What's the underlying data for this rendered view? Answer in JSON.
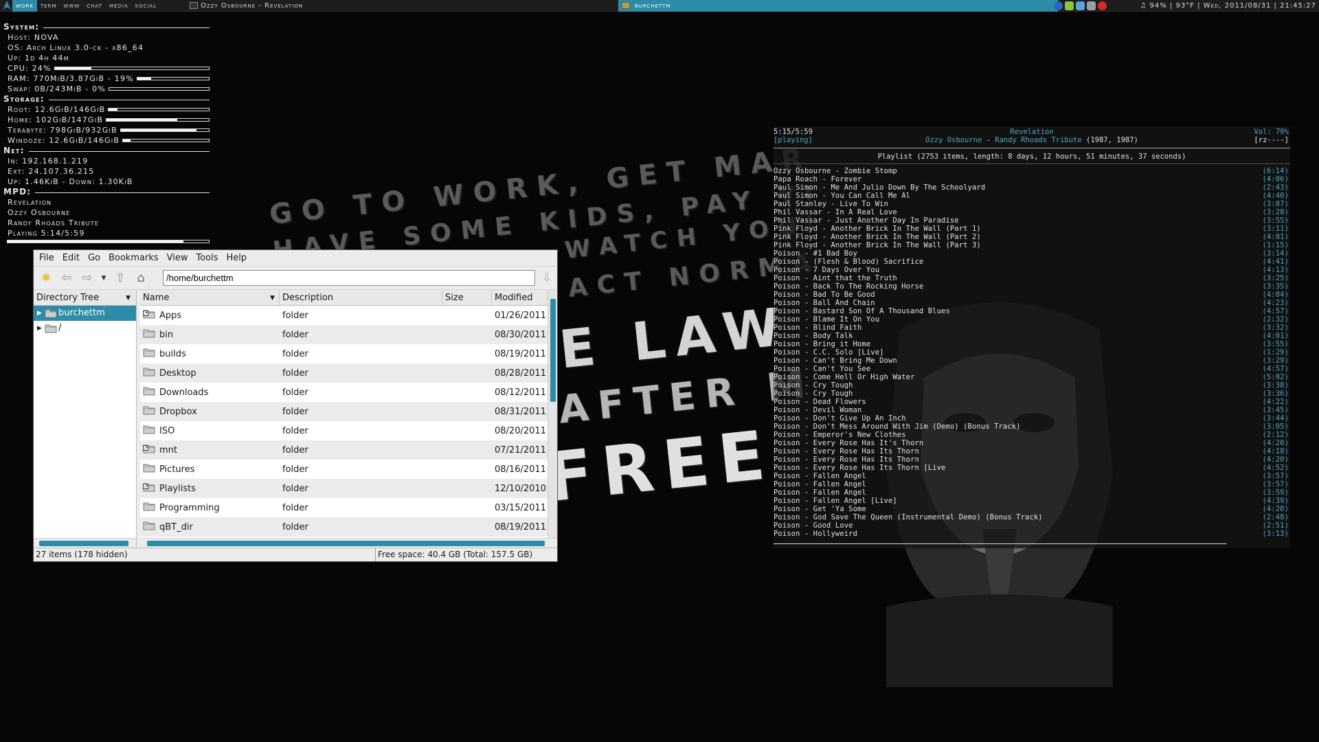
{
  "topbar": {
    "tags": [
      {
        "label": "work",
        "selected": true
      },
      {
        "label": "term",
        "selected": false
      },
      {
        "label": "www",
        "selected": false
      },
      {
        "label": "chat",
        "selected": false
      },
      {
        "label": "media",
        "selected": false
      },
      {
        "label": "social",
        "selected": false
      }
    ],
    "task_left": "Ozzy Osbourne - Revelation",
    "task_active": "burchettm",
    "tray_icons": [
      "network-icon",
      "pidgin-icon",
      "dropbox-icon",
      "updates-icon",
      "opera-icon"
    ],
    "status": "♫ 94% | 93°F | Wed, 2011/08/31 | 21:45:27",
    "accent": "#2d8ca8"
  },
  "conky": {
    "system_label": "System:",
    "host": "Host: NOVA",
    "os": "OS: Arch Linux 3.0-ck - x86_64",
    "uptime": "Up: 1d 4h 44m",
    "cpu": "CPU: 24%",
    "cpu_pct": 24,
    "ram": "RAM: 770MiB/3.87GiB - 19%",
    "ram_pct": 19,
    "swap": "Swap: 0B/243MiB - 0%",
    "swap_pct": 0,
    "storage_label": "Storage:",
    "root": "Root: 12.6GiB/146GiB",
    "root_pct": 9,
    "home": "Home: 102GiB/147GiB",
    "home_pct": 69,
    "terabyte": "Terabyte: 798GiB/932GiB",
    "terabyte_pct": 86,
    "windoze": "Windoze: 12.6GiB/146GiB",
    "windoze_pct": 9,
    "net_label": "Net:",
    "in": "In: 192.168.1.219",
    "ext": "Ext: 24.107.36.215",
    "traffic": "Up: 1.46KiB - Down: 1.30KiB",
    "mpd_label": "MPD:",
    "mpd_title": "Revelation",
    "mpd_artist": "Ozzy Osbourne",
    "mpd_album": "Randy Rhoads Tribute",
    "mpd_state": "Playing 5:14/5:59",
    "mpd_progress": 0.875
  },
  "wallpaper": {
    "lines": [
      "GO TO WORK, GET MARRIED",
      "HAVE SOME KIDS, PAY YOUR TAXES",
      "WATCH YOUR TV",
      "ACT NORMAL",
      "E LAW",
      "AFTER ME",
      "FREE"
    ]
  },
  "filemanager": {
    "menu": [
      "File",
      "Edit",
      "Go",
      "Bookmarks",
      "View",
      "Tools",
      "Help"
    ],
    "path": "/home/burchettm",
    "tree_header": "Directory Tree",
    "tree": [
      {
        "label": "burchettm",
        "selected": true
      },
      {
        "label": "/",
        "selected": false
      }
    ],
    "columns": [
      "Name",
      "Description",
      "Size",
      "Modified"
    ],
    "rows": [
      {
        "name": "Apps",
        "desc": "folder",
        "size": "",
        "modified": "01/26/2011 :",
        "link": true
      },
      {
        "name": "bin",
        "desc": "folder",
        "size": "",
        "modified": "08/30/2011 :",
        "link": false
      },
      {
        "name": "builds",
        "desc": "folder",
        "size": "",
        "modified": "08/19/2011 :",
        "link": false
      },
      {
        "name": "Desktop",
        "desc": "folder",
        "size": "",
        "modified": "08/28/2011 :",
        "link": false
      },
      {
        "name": "Downloads",
        "desc": "folder",
        "size": "",
        "modified": "08/12/2011 :",
        "link": false
      },
      {
        "name": "Dropbox",
        "desc": "folder",
        "size": "",
        "modified": "08/31/2011 :",
        "link": false
      },
      {
        "name": "ISO",
        "desc": "folder",
        "size": "",
        "modified": "08/20/2011 (",
        "link": false
      },
      {
        "name": "mnt",
        "desc": "folder",
        "size": "",
        "modified": "07/21/2011 :",
        "link": true
      },
      {
        "name": "Pictures",
        "desc": "folder",
        "size": "",
        "modified": "08/16/2011 :",
        "link": false
      },
      {
        "name": "Playlists",
        "desc": "folder",
        "size": "",
        "modified": "12/10/2010 :",
        "link": true
      },
      {
        "name": "Programming",
        "desc": "folder",
        "size": "",
        "modified": "03/15/2011 :",
        "link": false
      },
      {
        "name": "qBT_dir",
        "desc": "folder",
        "size": "",
        "modified": "08/19/2011 :",
        "link": false
      }
    ],
    "status_count": "27 items (178 hidden)",
    "status_free": "Free space: 40.4 GB (Total: 157.5 GB)"
  },
  "ncmpcpp": {
    "time": "5:15/5:59",
    "state": "[playing]",
    "title": "Revelation",
    "artist": "Ozzy Osbourne",
    "sep": " - ",
    "album": "Randy Rhoads Tribute",
    "year": " (1987, 1987)",
    "volume": "Vol: 70%",
    "flags": "[rz----]",
    "playlist_info": "Playlist (2753 items, length: 8 days, 12 hours, 51 minutes, 37 seconds)",
    "progress": 0.876,
    "songs": [
      {
        "t": "Ozzy Osbourne - Zombie Stomp",
        "d": "(6:14)"
      },
      {
        "t": "Papa Roach - Forever",
        "d": "(4:06)"
      },
      {
        "t": "Paul Simon - Me And Julio Down By The Schoolyard",
        "d": "(2:43)"
      },
      {
        "t": "Paul Simon - You Can Call Me Al",
        "d": "(4:40)"
      },
      {
        "t": "Paul Stanley - Live To Win",
        "d": "(3:07)"
      },
      {
        "t": "Phil Vassar - In A Real Love",
        "d": "(3:28)"
      },
      {
        "t": "Phil Vassar - Just Another Day In Paradise",
        "d": "(3:55)"
      },
      {
        "t": "Pink Floyd - Another Brick In The Wall (Part 1)",
        "d": "(3:11)"
      },
      {
        "t": "Pink Floyd - Another Brick In The Wall (Part 2)",
        "d": "(4:01)"
      },
      {
        "t": "Pink Floyd - Another Brick In The Wall (Part 3)",
        "d": "(1:15)"
      },
      {
        "t": "Poison - #1 Bad Boy",
        "d": "(3:14)"
      },
      {
        "t": "Poison - (Flesh & Blood) Sacrifice",
        "d": "(4:41)"
      },
      {
        "t": "Poison - 7 Days Over You",
        "d": "(4:13)"
      },
      {
        "t": "Poison - Aint that the Truth",
        "d": "(3:25)"
      },
      {
        "t": "Poison - Back To The Rocking Horse",
        "d": "(3:35)"
      },
      {
        "t": "Poison - Bad To Be Good",
        "d": "(4:04)"
      },
      {
        "t": "Poison - Ball And Chain",
        "d": "(4:23)"
      },
      {
        "t": "Poison - Bastard Son Of A Thousand Blues",
        "d": "(4:57)"
      },
      {
        "t": "Poison - Blame It On You",
        "d": "(2:32)"
      },
      {
        "t": "Poison - Blind Faith",
        "d": "(3:32)"
      },
      {
        "t": "Poison - Body Talk",
        "d": "(4:01)"
      },
      {
        "t": "Poison - Bring it Home",
        "d": "(3:55)"
      },
      {
        "t": "Poison - C.C. Solo [Live]",
        "d": "(1:29)"
      },
      {
        "t": "Poison - Can't Bring Me Down",
        "d": "(3:29)"
      },
      {
        "t": "Poison - Can't You See",
        "d": "(4:57)"
      },
      {
        "t": "Poison - Come Hell Or High Water",
        "d": "(5:02)"
      },
      {
        "t": "Poison - Cry Tough",
        "d": "(3:38)"
      },
      {
        "t": "Poison - Cry Tough",
        "d": "(3:36)"
      },
      {
        "t": "Poison - Dead Flowers",
        "d": "(4:22)"
      },
      {
        "t": "Poison - Devil Woman",
        "d": "(3:45)"
      },
      {
        "t": "Poison - Don't Give Up An Inch",
        "d": "(3:44)"
      },
      {
        "t": "Poison - Don't Mess Around With Jim (Demo) (Bonus Track)",
        "d": "(3:05)"
      },
      {
        "t": "Poison - Emperor's New Clothes",
        "d": "(2:12)"
      },
      {
        "t": "Poison - Every Rose Has It's Thorn",
        "d": "(4:20)"
      },
      {
        "t": "Poison - Every Rose Has Its Thorn",
        "d": "(4:18)"
      },
      {
        "t": "Poison - Every Rose Has Its Thorn",
        "d": "(4:20)"
      },
      {
        "t": "Poison - Every Rose Has Its Thorn [Live",
        "d": "(4:52)"
      },
      {
        "t": "Poison - Fallen Angel",
        "d": "(3:57)"
      },
      {
        "t": "Poison - Fallen Angel",
        "d": "(3:57)"
      },
      {
        "t": "Poison - Fallen Angel",
        "d": "(3:59)"
      },
      {
        "t": "Poison - Fallen Angel [Live]",
        "d": "(4:39)"
      },
      {
        "t": "Poison - Get 'Ya Some",
        "d": "(4:20)"
      },
      {
        "t": "Poison - God Save The Queen (Instrumental Demo) (Bonus Track)",
        "d": "(2:48)"
      },
      {
        "t": "Poison - Good Love",
        "d": "(2:51)"
      },
      {
        "t": "Poison - Hollyweird",
        "d": "(3:13)"
      }
    ]
  }
}
